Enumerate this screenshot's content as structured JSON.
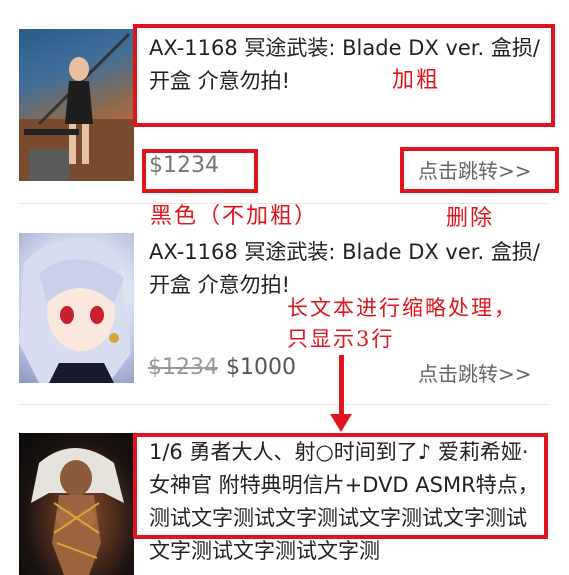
{
  "items": [
    {
      "title": "AX-1168 冥途武装: Blade DX ver. 盒损/开盒 介意勿拍!",
      "price": "$1234",
      "jump_label": "点击跳转>>",
      "thumb_alt": "action-figure-thumbnail"
    },
    {
      "title": "AX-1168 冥途武装: Blade DX ver. 盒损/开盒 介意勿拍!",
      "price_original": "$1234",
      "price_current": "$1000",
      "jump_label": "点击跳转>>",
      "thumb_alt": "anime-girl-thumbnail"
    },
    {
      "title": "1/6 勇者大人、射○时间到了♪ 爱莉希娅·女神官 附特典明信片+DVD ASMR特点，测试文字测试文字测试文字测试文字测试文字测试文字测试文字测",
      "thumb_alt": "figure-thumbnail"
    }
  ],
  "annotations": {
    "bold": "加粗",
    "black_not_bold": "黑色（不加粗）",
    "delete": "删除",
    "long_text_line1": "长文本进行缩略处理，",
    "long_text_line2": "只显示3行"
  },
  "colors": {
    "annotation_red": "#e0141c",
    "price_gray": "#777777",
    "text_dark": "#222222"
  }
}
